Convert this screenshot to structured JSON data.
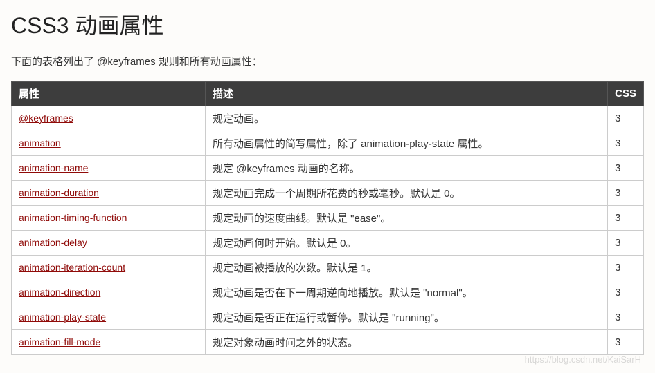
{
  "title": "CSS3 动画属性",
  "intro": "下面的表格列出了 @keyframes 规则和所有动画属性：",
  "thead": {
    "prop": "属性",
    "desc": "描述",
    "css": "CSS"
  },
  "rows": [
    {
      "prop": "@keyframes",
      "desc": "规定动画。",
      "css": "3"
    },
    {
      "prop": "animation",
      "desc": "所有动画属性的简写属性，除了 animation-play-state 属性。",
      "css": "3"
    },
    {
      "prop": "animation-name",
      "desc": "规定 @keyframes 动画的名称。",
      "css": "3"
    },
    {
      "prop": "animation-duration",
      "desc": "规定动画完成一个周期所花费的秒或毫秒。默认是 0。",
      "css": "3"
    },
    {
      "prop": "animation-timing-function",
      "desc": "规定动画的速度曲线。默认是 \"ease\"。",
      "css": "3"
    },
    {
      "prop": "animation-delay",
      "desc": "规定动画何时开始。默认是 0。",
      "css": "3"
    },
    {
      "prop": "animation-iteration-count",
      "desc": "规定动画被播放的次数。默认是 1。",
      "css": "3"
    },
    {
      "prop": "animation-direction",
      "desc": "规定动画是否在下一周期逆向地播放。默认是 \"normal\"。",
      "css": "3"
    },
    {
      "prop": "animation-play-state",
      "desc": "规定动画是否正在运行或暂停。默认是 \"running\"。",
      "css": "3"
    },
    {
      "prop": "animation-fill-mode",
      "desc": "规定对象动画时间之外的状态。",
      "css": "3"
    }
  ],
  "watermark": "https://blog.csdn.net/KaiSarH"
}
